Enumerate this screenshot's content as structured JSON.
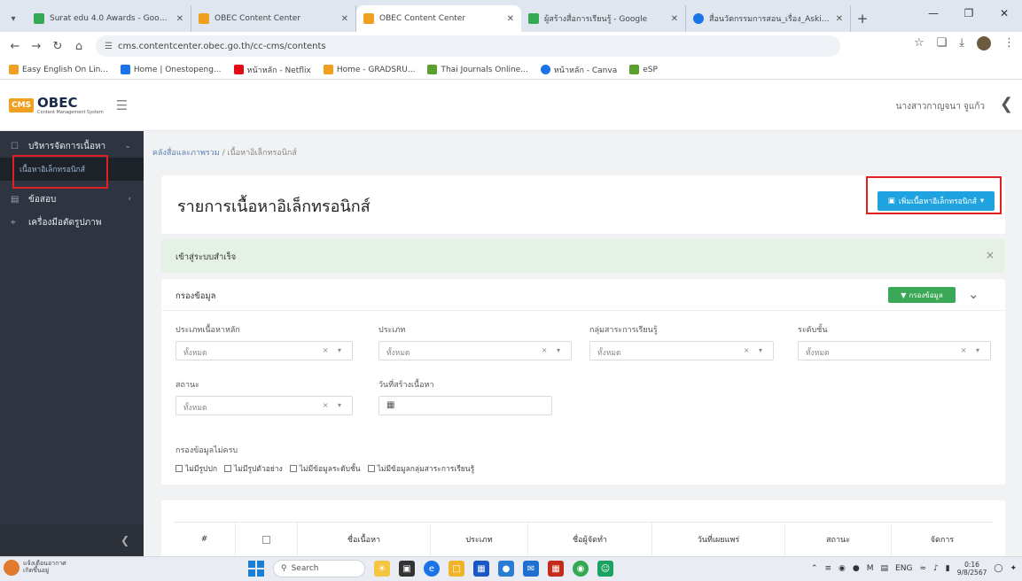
{
  "browser": {
    "tabs": [
      {
        "title": "Surat edu 4.0 Awards - Google",
        "favicon_color": "#34a853",
        "active": false
      },
      {
        "title": "OBEC Content Center",
        "favicon_color": "#f0a020",
        "active": false
      },
      {
        "title": "OBEC Content Center",
        "favicon_color": "#f0a020",
        "active": true
      },
      {
        "title": "ผู้สร้างสื่อการเรียนรู้ - Google",
        "favicon_color": "#34a853",
        "active": false
      },
      {
        "title": "สื่อนวัตกรรมการสอน_เรื่อง_Asking",
        "favicon_color": "#1a73e8",
        "active": false
      }
    ],
    "new_tab": "+",
    "url": "cms.contentcenter.obec.go.th/cc-cms/contents",
    "bookmarks": [
      {
        "label": "Easy English On Lin...",
        "color": "#f0a020"
      },
      {
        "label": "Home | Onestopeng...",
        "color": "#1a73e8"
      },
      {
        "label": "หน้าหลัก - Netflix",
        "color": "#e50914"
      },
      {
        "label": "Home - GRADSRU...",
        "color": "#f0a020"
      },
      {
        "label": "Thai Journals Online...",
        "color": "#5aa02c"
      },
      {
        "label": "หน้าหลัก - Canva",
        "color": "#1a73e8"
      },
      {
        "label": "eSP",
        "color": "#5aa02c"
      }
    ]
  },
  "app": {
    "logo_badge": "CMS",
    "logo_name": "OBEC",
    "logo_tagline": "Content Management System",
    "user_name": "นางสาวกาญจนา จูแก้ว"
  },
  "sidebar": {
    "items": [
      {
        "label": "บริหารจัดการเนื้อหา",
        "icon": "content-icon"
      },
      {
        "label": "ข้อสอบ",
        "icon": "exam-icon"
      },
      {
        "label": "เครื่องมือตัดรูปภาพ",
        "icon": "crop-icon"
      }
    ],
    "subitem": "เนื้อหาอิเล็กทรอนิกส์"
  },
  "breadcrumb": {
    "parent": "คลังสื่อและภาพรวม",
    "current": "เนื้อหาอิเล็กทรอนิกส์"
  },
  "page": {
    "title": "รายการเนื้อหาอิเล็กทรอนิกส์",
    "add_button": "เพิ่มเนื้อหาอิเล็กทรอนิกส์",
    "alert": "เข้าสู่ระบบสำเร็จ"
  },
  "filter": {
    "title": "กรองข้อมูล",
    "button": "กรองข้อมูล",
    "fields": [
      {
        "label": "ประเภทเนื้อหาหลัก",
        "value": "ทั้งหมด"
      },
      {
        "label": "ประเภท",
        "value": "ทั้งหมด"
      },
      {
        "label": "กลุ่มสาระการเรียนรู้",
        "value": "ทั้งหมด"
      },
      {
        "label": "ระดับชั้น",
        "value": "ทั้งหมด"
      },
      {
        "label": "สถานะ",
        "value": "ทั้งหมด"
      }
    ],
    "date_label": "วันที่สร้างเนื้อหา",
    "missing_label": "กรองข้อมูลไม่ครบ",
    "checkboxes": [
      "ไม่มีรูปปก",
      "ไม่มีรูปตัวอย่าง",
      "ไม่มีข้อมูลระดับชั้น",
      "ไม่มีข้อมูลกลุ่มสาระการเรียนรู้"
    ]
  },
  "table": {
    "columns": [
      "#",
      "",
      "ชื่อเนื้อหา",
      "ประเภท",
      "ชื่อผู้จัดทำ",
      "วันที่เผยแพร่",
      "สถานะ",
      "จัดการ"
    ]
  },
  "taskbar": {
    "weather_line1": "แจ้งเตือนอากาศ",
    "weather_line2": "เกิดขึ้นอยู่",
    "search": "Search",
    "lang": "ENG",
    "time": "0:16",
    "date": "9/8/2567"
  }
}
